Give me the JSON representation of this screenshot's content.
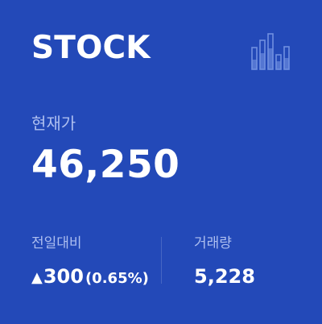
{
  "card": {
    "title": "STOCK",
    "logo_icon": "bar-chart-icon",
    "price_label": "현재가",
    "price": "46,250",
    "change_label": "전일대비",
    "change_arrow": "▲",
    "change_value": "300",
    "change_rate": "(0.65%)",
    "volume_label": "거래량",
    "volume": "5,228"
  },
  "colors": {
    "background": "#2349b8",
    "text": "#ffffff",
    "label": "#aebff0",
    "logo": "#6f8fe0"
  }
}
